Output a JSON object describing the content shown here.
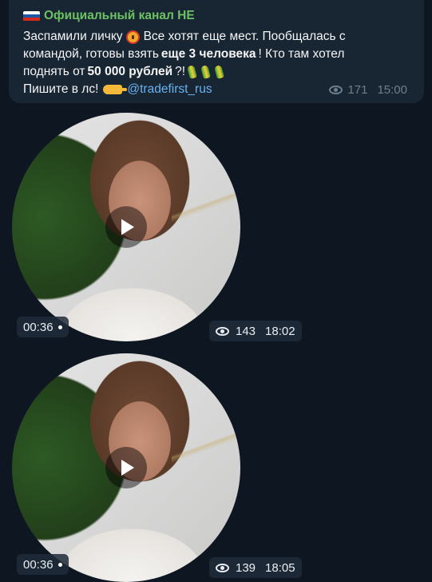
{
  "message": {
    "channel_name": "Официальный канал НЕ",
    "flag_colors": [
      "#ffffff",
      "#1c57a5",
      "#d52b1e"
    ],
    "line1_a": "Заспамили личку",
    "line1_b": "Все хотят еще мест. Пообщалась с",
    "line2_a": "командой, готовы взять",
    "line2_bold": "еще 3 человека",
    "line2_b": "! Кто там хотел",
    "line3_a": "поднять от",
    "line3_bold": "50 000 рублей",
    "line3_b": "?!",
    "line4_a": "Пишите в лс!",
    "link": "@tradefirst_rus",
    "views": "171",
    "time": "15:00"
  },
  "videos": [
    {
      "duration": "00:36",
      "views": "143",
      "time": "18:02"
    },
    {
      "duration": "00:36",
      "views": "139",
      "time": "18:05"
    }
  ],
  "icons": [
    "russia-flag-icon",
    "alarm-emoji-icon",
    "corn-emoji-icon",
    "pointing-hand-emoji-icon",
    "eye-icon",
    "play-icon"
  ]
}
